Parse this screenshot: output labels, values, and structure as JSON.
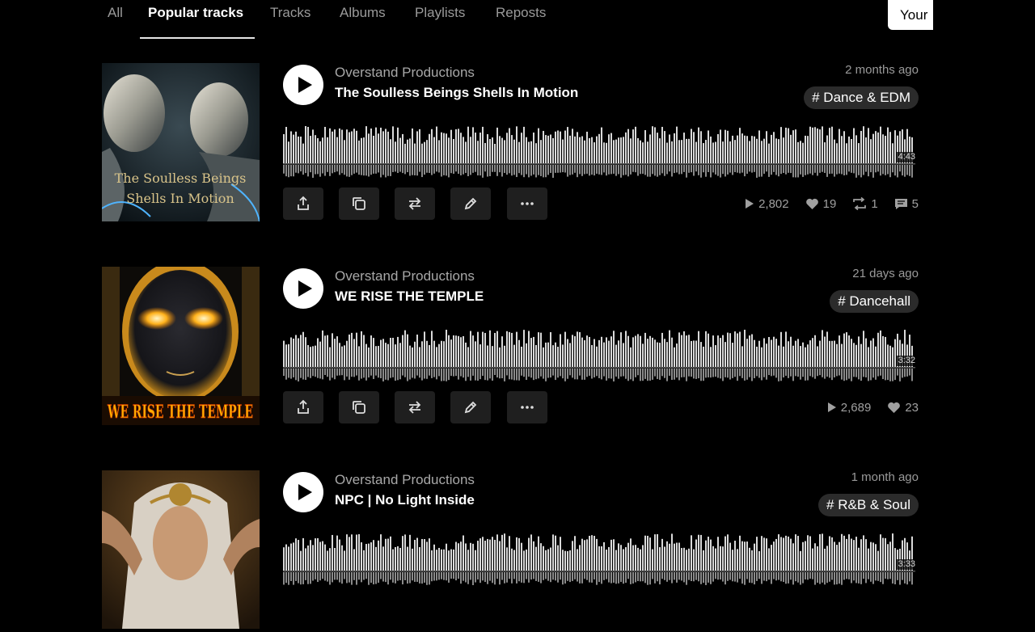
{
  "tabs": [
    "All",
    "Popular tracks",
    "Tracks",
    "Albums",
    "Playlists",
    "Reposts"
  ],
  "active_tab": "Popular tracks",
  "your_button": "Your",
  "icons": {
    "play": "play-icon",
    "share": "share-icon",
    "copy": "copy-icon",
    "repost": "repost-icon",
    "edit": "pencil-icon",
    "more": "more-icon",
    "plays": "play-count-icon",
    "likes": "heart-icon",
    "reposts": "repost-count-icon",
    "comments": "comment-icon"
  },
  "tracks": [
    {
      "artist": "Overstand Productions",
      "title": "The Soulless Beings Shells In Motion",
      "date": "2 months ago",
      "tag": "# Dance & EDM",
      "duration": "4:43",
      "plays": "2,802",
      "likes": "19",
      "reposts": "1",
      "comments": "5",
      "artwork_text": [
        "The Soulless Beings",
        "Shells In Motion"
      ]
    },
    {
      "artist": "Overstand Productions",
      "title": "WE RISE THE TEMPLE",
      "date": "21 days ago",
      "tag": "# Dancehall",
      "duration": "3:32",
      "plays": "2,689",
      "likes": "23",
      "artwork_text": [
        "WE RISE THE TEMPLE"
      ]
    },
    {
      "artist": "Overstand Productions",
      "title": "NPC | No Light Inside",
      "date": "1 month ago",
      "tag": "# R&B & Soul",
      "duration": "3:33"
    }
  ],
  "colors": {
    "background": "#000000",
    "waveform": "#d9d9d9",
    "tag_bg": "#2b2b2b",
    "button_bg": "#1f1f1f",
    "muted_text": "#a8a8a8"
  }
}
